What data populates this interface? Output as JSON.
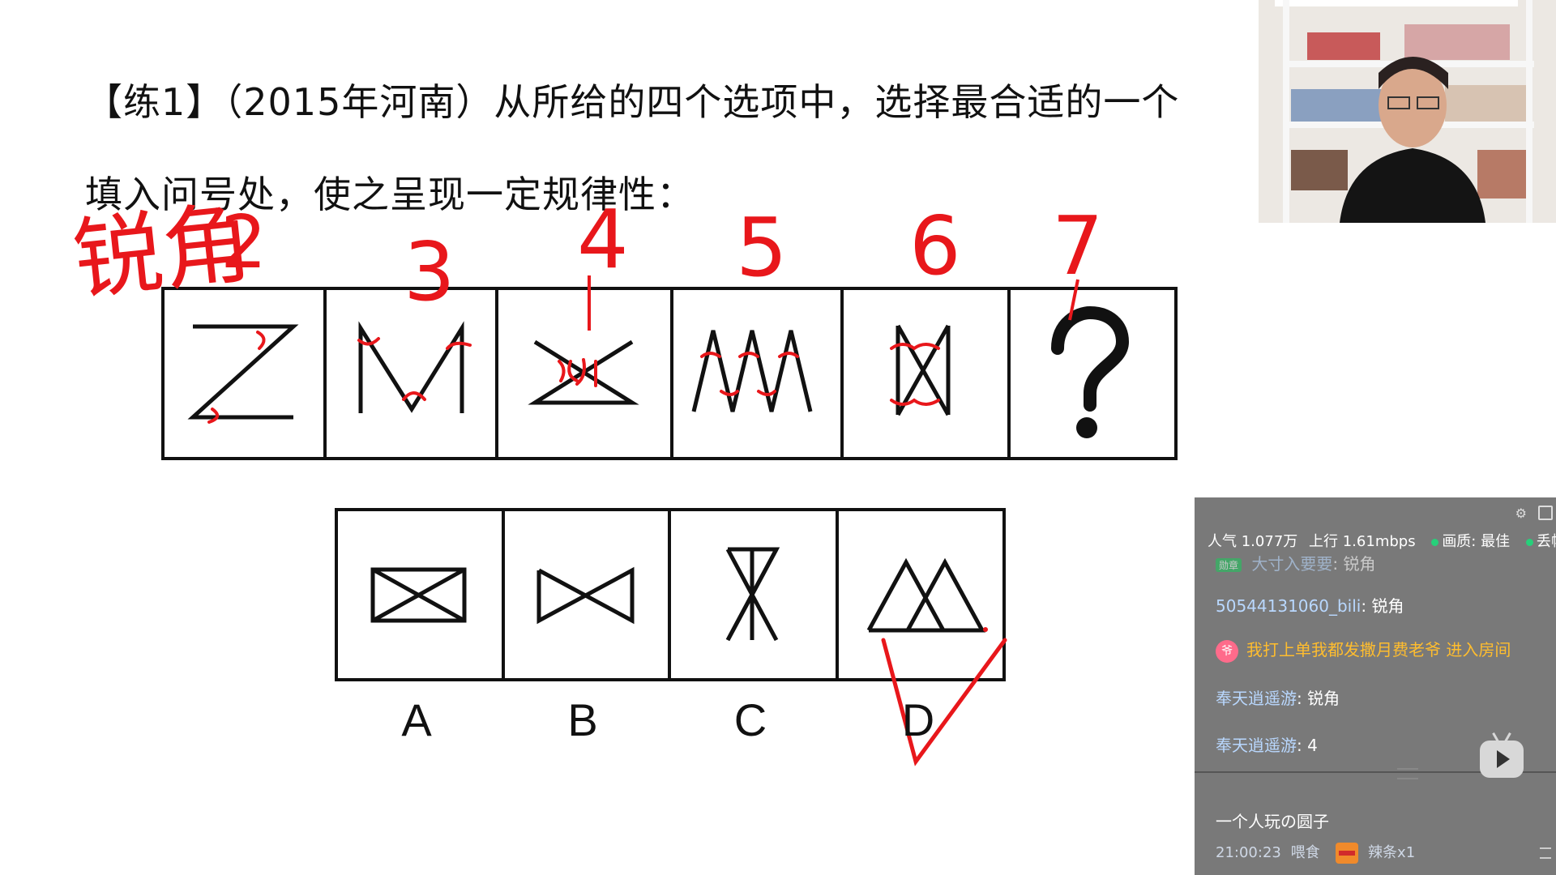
{
  "question": {
    "line1": "【练1】（2015年河南）从所给的四个选项中，选择最合适的一个",
    "line2": "填入问号处，使之呈现一定规律性："
  },
  "handwriting": {
    "row_label": "锐角",
    "numbers": [
      "2",
      "3",
      "4",
      "5",
      "6",
      "7"
    ]
  },
  "options": {
    "letters": [
      "A",
      "B",
      "C",
      "D"
    ],
    "correct": "D"
  },
  "sequence": {
    "missing_mark": "?"
  },
  "chat": {
    "stats": {
      "popularity_label": "人气",
      "popularity_value": "1.077万",
      "upload_label": "上行",
      "upload_value": "1.61mbps",
      "quality": "画质: 最佳",
      "frames": "丢帧"
    },
    "messages": [
      {
        "user": "大寸入要要",
        "text": "锐角"
      },
      {
        "user": "50544131060_bili",
        "text": "锐角"
      },
      {
        "system": "我打上单我都发撒月费老爷 进入房间",
        "icon_text": "爷"
      },
      {
        "user": "奉天逍遥游",
        "text": "锐角"
      },
      {
        "user": "奉天逍遥游",
        "text": "4"
      }
    ],
    "room_name": "一个人玩の圆子",
    "gift": {
      "time": "21:00:23",
      "sender": "喂食",
      "item": "辣条x1"
    }
  },
  "colors": {
    "ink": "#111111",
    "annotation": "#e8171b",
    "chat_bg": "#6e6e6e"
  }
}
